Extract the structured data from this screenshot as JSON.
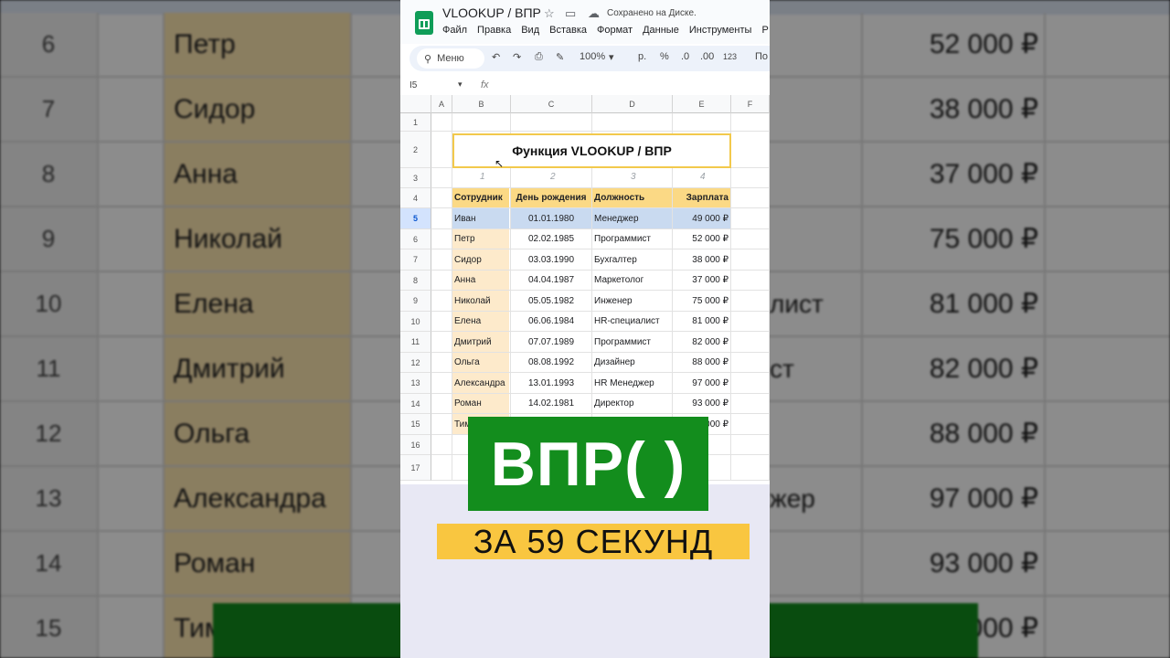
{
  "app": {
    "doc_title": "VLOOKUP / ВПР",
    "save_status": "Сохранено на Диске.",
    "menu": [
      "Файл",
      "Правка",
      "Вид",
      "Вставка",
      "Формат",
      "Данные",
      "Инструменты",
      "Р"
    ],
    "toolbar": {
      "search_placeholder": "Меню",
      "zoom": "100%",
      "currency": "р.",
      "percent": "%",
      "dec_less": ".0",
      "dec_more": ".00",
      "number_format": "123",
      "more": "По"
    },
    "name_box": "I5",
    "fx": "fx"
  },
  "sheet": {
    "columns": [
      "A",
      "B",
      "C",
      "D",
      "E",
      "F"
    ],
    "row_numbers": [
      "1",
      "2",
      "3",
      "4",
      "5",
      "6",
      "7",
      "8",
      "9",
      "10",
      "11",
      "12",
      "13",
      "14",
      "15",
      "16",
      "17"
    ],
    "active_row": "5",
    "title": "Функция VLOOKUP / ВПР",
    "column_index": [
      "1",
      "2",
      "3",
      "4"
    ],
    "headers": [
      "Сотрудник",
      "День рождения",
      "Должность",
      "Зарплата"
    ],
    "rows": [
      {
        "name": "Иван",
        "date": "01.01.1980",
        "role": "Менеджер",
        "salary": "49 000 ₽"
      },
      {
        "name": "Петр",
        "date": "02.02.1985",
        "role": "Программист",
        "salary": "52 000 ₽"
      },
      {
        "name": "Сидор",
        "date": "03.03.1990",
        "role": "Бухгалтер",
        "salary": "38 000 ₽"
      },
      {
        "name": "Анна",
        "date": "04.04.1987",
        "role": "Маркетолог",
        "salary": "37 000 ₽"
      },
      {
        "name": "Николай",
        "date": "05.05.1982",
        "role": "Инженер",
        "salary": "75 000 ₽"
      },
      {
        "name": "Елена",
        "date": "06.06.1984",
        "role": "HR-специалист",
        "salary": "81 000 ₽"
      },
      {
        "name": "Дмитрий",
        "date": "07.07.1989",
        "role": "Программист",
        "salary": "82 000 ₽"
      },
      {
        "name": "Ольга",
        "date": "08.08.1992",
        "role": "Дизайнер",
        "salary": "88 000 ₽"
      },
      {
        "name": "Александра",
        "date": "13.01.1993",
        "role": "HR Менеджер",
        "salary": "97 000 ₽"
      },
      {
        "name": "Роман",
        "date": "14.02.1981",
        "role": "Директор",
        "salary": "93 000 ₽"
      },
      {
        "name": "Тим",
        "date": "",
        "role": "",
        "salary": "000 ₽"
      }
    ]
  },
  "overlay": {
    "headline": "ВПР( )",
    "subline": "ЗА 59 СЕКУНД"
  },
  "background": {
    "rows": [
      {
        "num": "6",
        "name": "Петр",
        "role": "",
        "salary": "52 000 ₽"
      },
      {
        "num": "7",
        "name": "Сидор",
        "role": "",
        "salary": "38 000 ₽"
      },
      {
        "num": "8",
        "name": "Анна",
        "role": "",
        "salary": "37 000 ₽"
      },
      {
        "num": "9",
        "name": "Николай",
        "role": "",
        "salary": "75 000 ₽"
      },
      {
        "num": "10",
        "name": "Елена",
        "role": "лист",
        "salary": "81 000 ₽"
      },
      {
        "num": "11",
        "name": "Дмитрий",
        "role": "ст",
        "salary": "82 000 ₽"
      },
      {
        "num": "12",
        "name": "Ольга",
        "role": "",
        "salary": "88 000 ₽"
      },
      {
        "num": "13",
        "name": "Александра",
        "role": "жер",
        "salary": "97 000 ₽"
      },
      {
        "num": "14",
        "name": "Роман",
        "role": "",
        "salary": "93 000 ₽"
      },
      {
        "num": "15",
        "name": "Тим",
        "role": "",
        "salary": "000 ₽"
      }
    ]
  },
  "colors": {
    "name_fill": "#fdeacb",
    "header_fill": "#fbd985",
    "selection": "#c9daf0",
    "title_border": "#f2c94c",
    "green_badge": "#138d1d",
    "yellow_badge": "#f9c640"
  }
}
